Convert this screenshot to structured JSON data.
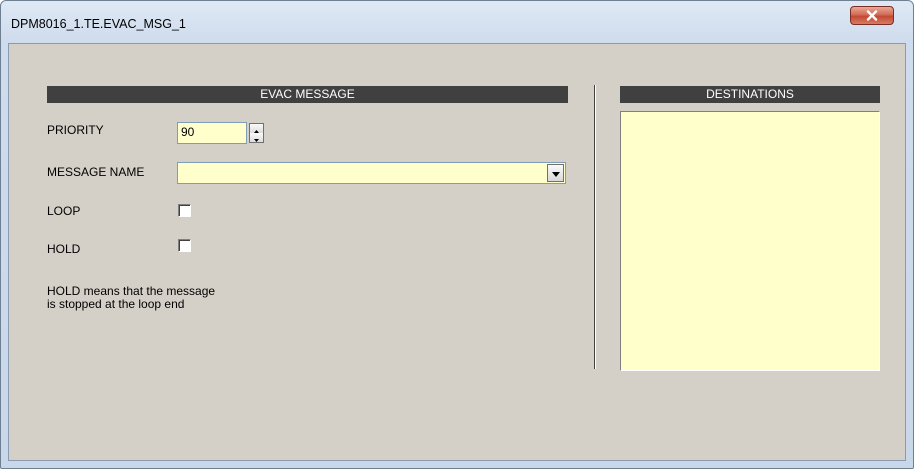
{
  "window": {
    "title": "DPM8016_1.TE.EVAC_MSG_1",
    "close_icon": "close-icon"
  },
  "evac_message": {
    "header": "EVAC MESSAGE",
    "priority_label": "PRIORITY",
    "priority_value": "90",
    "message_name_label": "MESSAGE NAME",
    "message_name_value": "",
    "loop_label": "LOOP",
    "loop_checked": false,
    "hold_label": "HOLD",
    "hold_checked": false,
    "hold_note_line1": "HOLD means that the message",
    "hold_note_line2": "is stopped at the loop end"
  },
  "destinations": {
    "header": "DESTINATIONS",
    "items": []
  },
  "colors": {
    "field_background": "#ffffcc",
    "header_background": "#404040",
    "panel_background": "#d4d0c8",
    "close_button": "#c24a34"
  }
}
